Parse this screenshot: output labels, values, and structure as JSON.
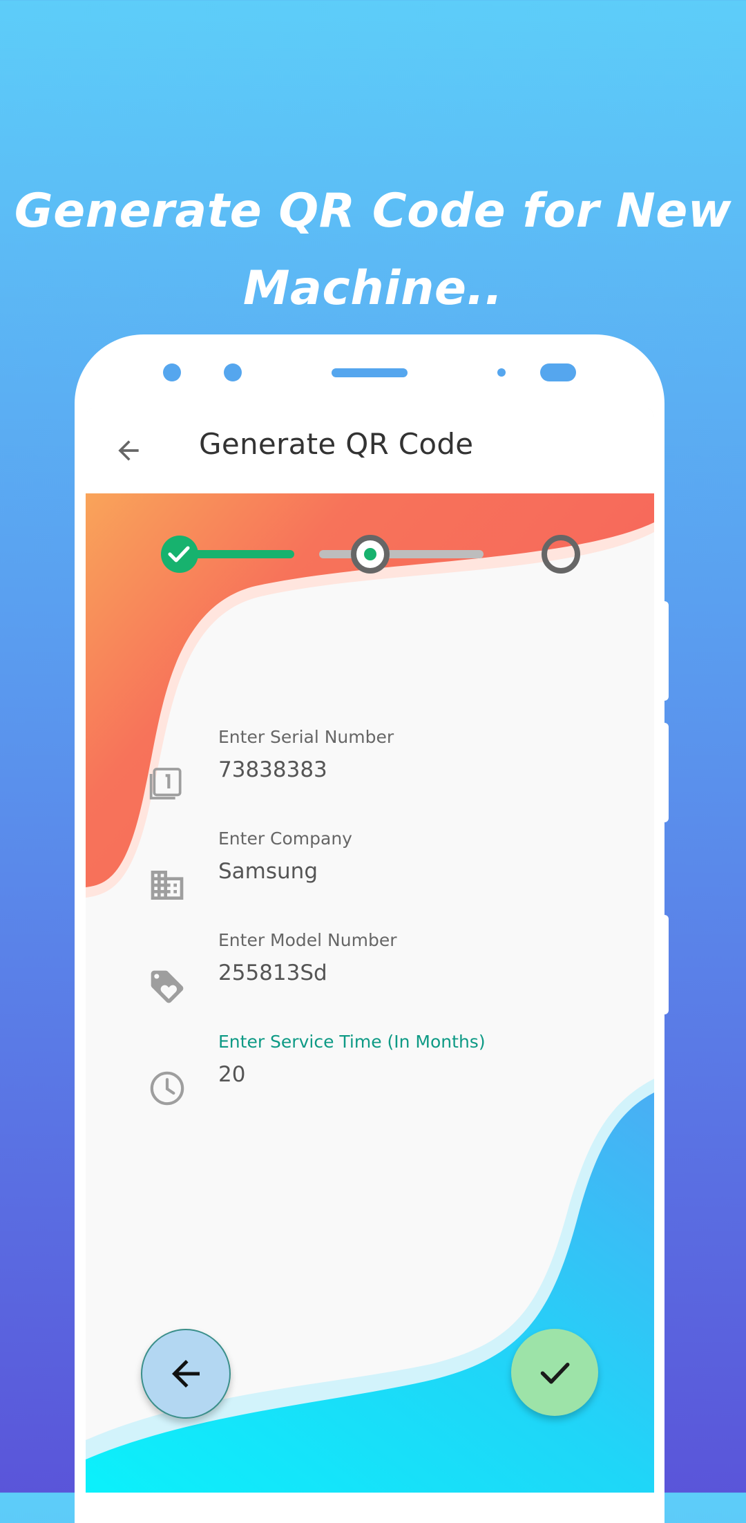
{
  "promo": {
    "headline_line1": "Generate QR Code for New",
    "headline_line2": "Machine.."
  },
  "appbar": {
    "title": "Generate QR Code",
    "back_icon": "arrow-left-icon"
  },
  "stepper": {
    "steps": [
      {
        "state": "completed"
      },
      {
        "state": "current"
      },
      {
        "state": "pending"
      }
    ],
    "colors": {
      "completed": "#17B26E",
      "current": "#666666",
      "pending": "#BDBDBD"
    }
  },
  "form": {
    "fields": [
      {
        "label": "Enter Serial Number",
        "value": "73838383",
        "icon": "serial-number-icon"
      },
      {
        "label": "Enter Company",
        "value": "Samsung",
        "icon": "company-building-icon"
      },
      {
        "label": "Enter Model Number",
        "value": "255813Sd",
        "icon": "tag-heart-icon"
      },
      {
        "label": "Enter Service Time (In Months)",
        "value": "20",
        "icon": "clock-icon",
        "focused": true
      }
    ]
  },
  "buttons": {
    "previous_icon": "arrow-left-icon",
    "submit_icon": "check-icon"
  },
  "colors": {
    "background_top": "#5DCDF9",
    "background_bottom": "#5A55D9",
    "accent_teal": "#0E9A85",
    "wave_top": "#F77A5A",
    "wave_bottom": "#22D5F7"
  }
}
